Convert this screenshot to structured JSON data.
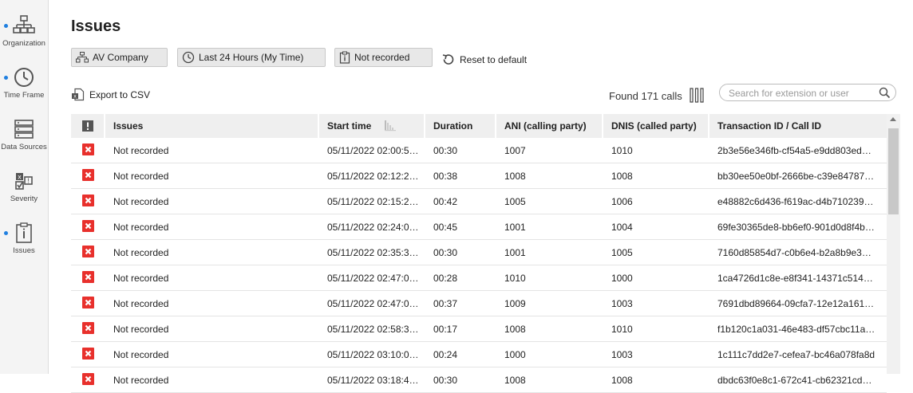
{
  "sidebar": {
    "items": [
      {
        "label": "Organization",
        "active": true,
        "icon": "org-chart-icon"
      },
      {
        "label": "Time Frame",
        "active": true,
        "icon": "clock-icon"
      },
      {
        "label": "Data Sources",
        "active": false,
        "icon": "server-icon"
      },
      {
        "label": "Severity",
        "active": false,
        "icon": "severity-icon"
      },
      {
        "label": "Issues",
        "active": true,
        "icon": "clipboard-info-icon"
      }
    ]
  },
  "header": {
    "title": "Issues",
    "filters": {
      "organization": "AV Company",
      "time_frame": "Last 24 Hours (My Time)",
      "issue": "Not recorded"
    },
    "reset_label": "Reset to default"
  },
  "toolbar": {
    "export_label": "Export to CSV",
    "found_label": "Found 171 calls",
    "search_placeholder": "Search for extension or user"
  },
  "table": {
    "columns": [
      "Issues",
      "Start time",
      "Duration",
      "ANI (calling party)",
      "DNIS (called party)",
      "Transaction ID / Call ID"
    ],
    "rows": [
      {
        "issue": "Not recorded",
        "start": "05/11/2022 02:00:5…",
        "duration": "00:30",
        "ani": "1007",
        "dnis": "1010",
        "txid": "2b3e56e346fb-cf54a5-e9dd803ed…"
      },
      {
        "issue": "Not recorded",
        "start": "05/11/2022 02:12:2…",
        "duration": "00:38",
        "ani": "1008",
        "dnis": "1008",
        "txid": "bb30ee50e0bf-2666be-c39e84787…"
      },
      {
        "issue": "Not recorded",
        "start": "05/11/2022 02:15:2…",
        "duration": "00:42",
        "ani": "1005",
        "dnis": "1006",
        "txid": "e48882c6d436-f619ac-d4b710239…"
      },
      {
        "issue": "Not recorded",
        "start": "05/11/2022 02:24:0…",
        "duration": "00:45",
        "ani": "1001",
        "dnis": "1004",
        "txid": "69fe30365de8-bb6ef0-901d0d8f4b…"
      },
      {
        "issue": "Not recorded",
        "start": "05/11/2022 02:35:3…",
        "duration": "00:30",
        "ani": "1001",
        "dnis": "1005",
        "txid": "7160d85854d7-c0b6e4-b2a8b9e3…"
      },
      {
        "issue": "Not recorded",
        "start": "05/11/2022 02:47:0…",
        "duration": "00:28",
        "ani": "1010",
        "dnis": "1000",
        "txid": "1ca4726d1c8e-e8f341-14371c514…"
      },
      {
        "issue": "Not recorded",
        "start": "05/11/2022 02:47:0…",
        "duration": "00:37",
        "ani": "1009",
        "dnis": "1003",
        "txid": "7691dbd89664-09cfa7-12e12a161…"
      },
      {
        "issue": "Not recorded",
        "start": "05/11/2022 02:58:3…",
        "duration": "00:17",
        "ani": "1008",
        "dnis": "1010",
        "txid": "f1b120c1a031-46e483-df57cbc11a…"
      },
      {
        "issue": "Not recorded",
        "start": "05/11/2022 03:10:0…",
        "duration": "00:24",
        "ani": "1000",
        "dnis": "1003",
        "txid": "1c111c7dd2e7-cefea7-bc46a078fa8d"
      },
      {
        "issue": "Not recorded",
        "start": "05/11/2022 03:18:4…",
        "duration": "00:30",
        "ani": "1008",
        "dnis": "1008",
        "txid": "dbdc63f0e8c1-672c41-cb62321cd…"
      }
    ]
  },
  "colors": {
    "accent": "#1f7fe0",
    "error": "#e8302c",
    "header_bg": "#efefef"
  }
}
